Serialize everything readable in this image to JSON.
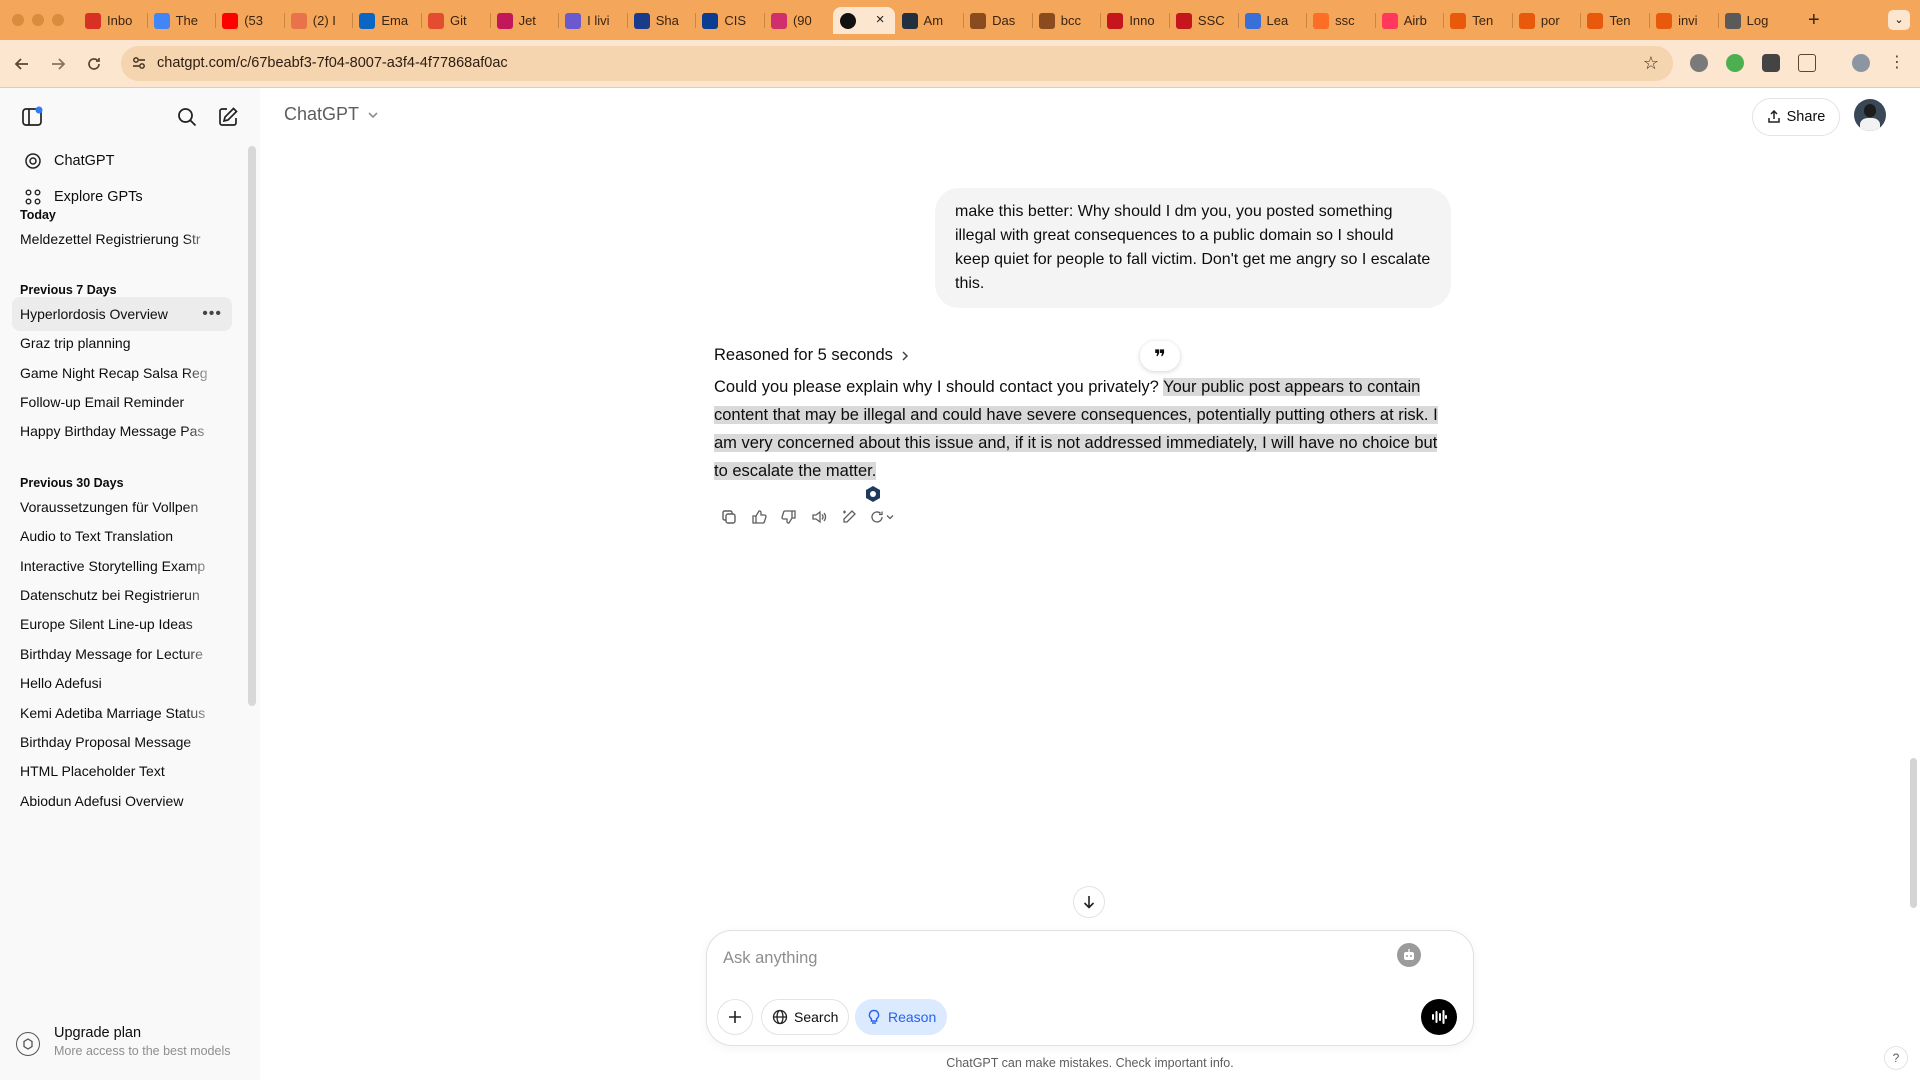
{
  "browser": {
    "tabs": [
      {
        "label": "Inbo",
        "color": "#d93025"
      },
      {
        "label": "The",
        "color": "#4285f4"
      },
      {
        "label": "(53",
        "color": "#ff0000"
      },
      {
        "label": "(2) I",
        "color": "#e8734a"
      },
      {
        "label": "Ema",
        "color": "#0a66c2"
      },
      {
        "label": "Git",
        "color": "#e44c30"
      },
      {
        "label": "Jet",
        "color": "#c2185b"
      },
      {
        "label": "I livi",
        "color": "#6a5acd"
      },
      {
        "label": "Sha",
        "color": "#1a3a8a"
      },
      {
        "label": "CIS",
        "color": "#0a3d91"
      },
      {
        "label": "(90",
        "color": "#d12f6b"
      },
      {
        "label": "",
        "color": "#111111",
        "active": true
      },
      {
        "label": "Am",
        "color": "#232f3e"
      },
      {
        "label": "Das",
        "color": "#8a4b1f"
      },
      {
        "label": "bcc",
        "color": "#8a4b1f"
      },
      {
        "label": "Inno",
        "color": "#c4161c"
      },
      {
        "label": "SSC",
        "color": "#c4161c"
      },
      {
        "label": "Lea",
        "color": "#3a6fd8"
      },
      {
        "label": "ssc",
        "color": "#fc6d26"
      },
      {
        "label": "Airb",
        "color": "#ff385c"
      },
      {
        "label": "Ten",
        "color": "#e8590c"
      },
      {
        "label": "por",
        "color": "#e8590c"
      },
      {
        "label": "Ten",
        "color": "#e8590c"
      },
      {
        "label": "invi",
        "color": "#e8590c"
      },
      {
        "label": "Log",
        "color": "#5a5a5a"
      }
    ],
    "tab_close_icon": "×",
    "new_tab_label": "+",
    "url": "chatgpt.com/c/67beabf3-7f04-8007-a3f4-4f77868af0ac"
  },
  "sidebar": {
    "top_items": [
      {
        "label": "ChatGPT",
        "icon": "openai-logo-icon"
      },
      {
        "label": "Explore GPTs",
        "icon": "grid-icon"
      }
    ],
    "sections": [
      {
        "title": "Today",
        "items": [
          "Meldezettel Registrierung Str"
        ]
      },
      {
        "title": "Previous 7 Days",
        "items": [
          "Hyperlordosis Overview",
          "Graz trip planning",
          "Game Night Recap Salsa Reg",
          "Follow-up Email Reminder",
          "Happy Birthday Message Pas"
        ]
      },
      {
        "title": "Previous 30 Days",
        "items": [
          "Voraussetzungen für Vollpen",
          "Audio to Text Translation",
          "Interactive Storytelling Examp",
          "Datenschutz bei Registrierun",
          "Europe Silent Line-up Ideas",
          "Birthday Message for Lecture",
          "Hello Adefusi",
          "Kemi Adetiba Marriage Status",
          "Birthday Proposal Message",
          "HTML Placeholder Text",
          "Abiodun Adefusi Overview"
        ]
      }
    ],
    "active_item": "Hyperlordosis Overview",
    "more_label": "•••",
    "upgrade": {
      "title": "Upgrade plan",
      "subtitle": "More access to the best models"
    }
  },
  "header": {
    "model": "ChatGPT",
    "share_label": "Share"
  },
  "conversation": {
    "user_message": "make this better: Why should I dm you, you posted something illegal with great consequences to a public domain so I should keep quiet for people to fall victim. Don't get me angry so I escalate this.",
    "reasoned_label": "Reasoned for 5 seconds",
    "quote_label": "❞",
    "answer_plain": "Could you please explain why I should contact you privately? ",
    "answer_highlighted": "Your public post appears to contain content that may be illegal and could have severe consequences, potentially putting others at risk. I am very concerned about this issue and, if it is not addressed immediately, I will have no choice but to escalate the matter."
  },
  "composer": {
    "placeholder": "Ask anything",
    "search_label": "Search",
    "reason_label": "Reason",
    "reason_color": "#2563eb"
  },
  "footer": {
    "disclaimer": "ChatGPT can make mistakes. Check important info.",
    "help_label": "?"
  }
}
